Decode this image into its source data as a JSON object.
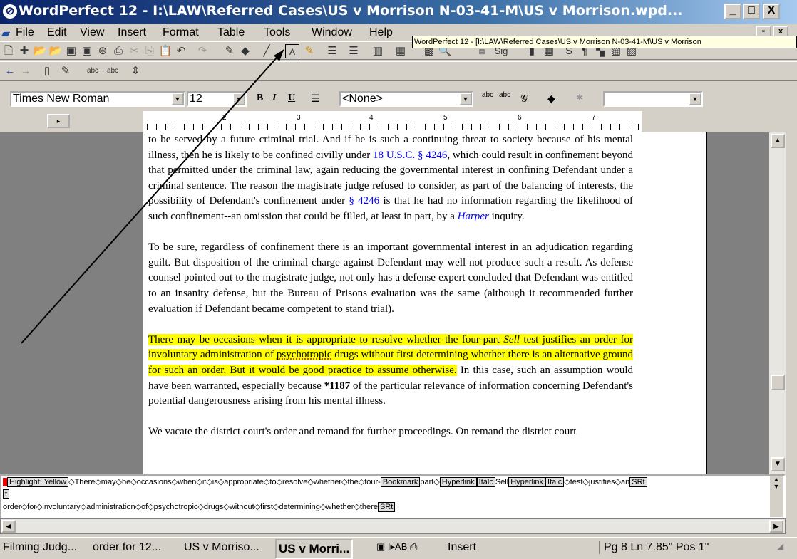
{
  "window": {
    "title": "WordPerfect 12 - I:\\LAW\\Referred Cases\\US v Morrison N-03-41-M\\US v Morrison.wpd...",
    "minimize": "_",
    "maximize": "□",
    "close": "X"
  },
  "menu": {
    "items": [
      "File",
      "Edit",
      "View",
      "Insert",
      "Format",
      "Table",
      "Tools",
      "Window",
      "Help"
    ]
  },
  "tooltip": "WordPerfect 12 - [I:\\LAW\\Referred Cases\\US v Morrison N-03-41-M\\US v Morrison",
  "property_bar": {
    "font": "Times New Roman",
    "size": "12",
    "style": "<None>",
    "bold": "B",
    "italic": "I",
    "underline": "U"
  },
  "toolbar": {
    "sig": "Sig",
    "abc1": "abc",
    "abc2": "abc"
  },
  "ruler": {
    "numbers": [
      "2",
      "3",
      "4",
      "5",
      "6",
      "7"
    ]
  },
  "document": {
    "para1_a": "to be served by a future criminal trial.  And if he is such a continuing threat to society because of his mental illness, then he is likely to be confined civilly under ",
    "para1_link1": "18 U.S.C. § 4246",
    "para1_b": ", which could result in confinement beyond that permitted under the criminal law, again reducing the governmental interest in confining Defendant under a criminal sentence.  The reason the magistrate judge refused to consider, as part of the balancing of interests, the possibility of Defendant's confinement under ",
    "para1_link2": "§ 4246",
    "para1_c": " is that he had no information regarding the likelihood of such confinement--an omission that could be filled, at least in part, by a ",
    "para1_link3": "Harper",
    "para1_d": " inquiry.",
    "para2": "To be sure, regardless of confinement there is an important governmental interest in an adjudication regarding guilt.  But disposition of the criminal charge against Defendant may well not produce such a result.  As defense counsel pointed out to the magistrate judge, not only has a defense expert concluded that Defendant was entitled to an insanity defense, but the Bureau of Prisons evaluation was the same (although it recommended further evaluation if Defendant became competent to stand trial).",
    "para3_hl_a": "There may be occasions when it is appropriate to resolve whether the four-part ",
    "para3_hl_sell": "Sell",
    "para3_hl_b": " test justifies an order for involuntary administration of ",
    "para3_hl_psy": "psychotropic",
    "para3_hl_c": " drugs without first determining whether there is an alternative ground for such an order.  But it would be good practice to assume otherwise.",
    "para3_rest_a": " In this case, such an assumption would have been warranted, especially because ",
    "para3_bold": "*1187",
    "para3_rest_b": " of the particular relevance of information concerning Defendant's potential dangerousness arising from his mental illness.",
    "para4": "We vacate the district court's order and remand for further proceedings.  On remand the district court"
  },
  "reveal_codes": {
    "highlight": "Highlight: Yellow",
    "line1_a": "◇There◇may◇be◇occasions◇when◇it◇is◇appropriate◇to◇resolve◇whether◇the◇four-",
    "bookmark": "Bookmark",
    "line1_b": "part◇",
    "hyperlink1": "Hyperlink",
    "italc1": "Italc",
    "line1_c": "Sell",
    "hyperlink2": "Hyperlink",
    "italc2": "Italc",
    "line1_d": "◇test◇justifies◇an",
    "srt1": "SRt",
    "line2": "t",
    "line3": "order◇for◇involuntary◇administration◇of◇psychotropic◇drugs◇without◇first◇determining◇whether◇there",
    "srt2": "SRt"
  },
  "status": {
    "task1": "Filming Judg...",
    "task2": "order for 12...",
    "task3": "US v Morriso...",
    "task4": "US v Morri...",
    "mode": "Insert",
    "position": "Pg 8 Ln 7.85\" Pos 1\""
  }
}
